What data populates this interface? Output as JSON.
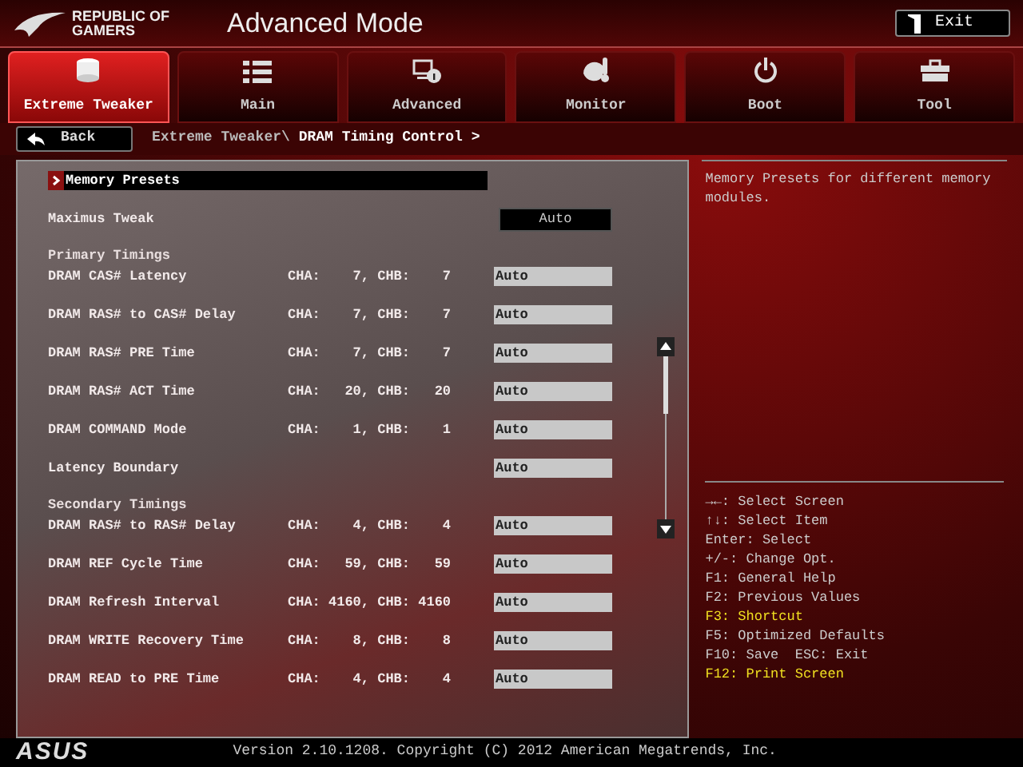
{
  "header": {
    "brand": [
      "REPUBLIC OF",
      "GAMERS"
    ],
    "title": "Advanced Mode",
    "exit_button": "Exit"
  },
  "tabs": [
    {
      "label": "Extreme Tweaker",
      "selected": true
    },
    {
      "label": "Main",
      "selected": false
    },
    {
      "label": "Advanced",
      "selected": false
    },
    {
      "label": "Monitor",
      "selected": false
    },
    {
      "label": "Boot",
      "selected": false
    },
    {
      "label": "Tool",
      "selected": false
    }
  ],
  "back_button": "Back",
  "breadcrumb": {
    "parent": "Extreme Tweaker\\",
    "current": "DRAM Timing Control >"
  },
  "items": [
    {
      "kind": "submenu",
      "label": "Memory Presets",
      "selected": true
    },
    {
      "kind": "option",
      "label": "Maximus Tweak",
      "value": "Auto",
      "selected": false
    },
    {
      "kind": "section",
      "label": "Primary Timings"
    },
    {
      "kind": "timing",
      "label": "DRAM CAS# Latency",
      "reading": "CHA:    7, CHB:    7",
      "value": "Auto",
      "selected": false
    },
    {
      "kind": "timing",
      "label": "DRAM RAS# to CAS# Delay",
      "reading": "CHA:    7, CHB:    7",
      "value": "Auto",
      "selected": false
    },
    {
      "kind": "timing",
      "label": "DRAM RAS# PRE Time",
      "reading": "CHA:    7, CHB:    7",
      "value": "Auto",
      "selected": false
    },
    {
      "kind": "timing",
      "label": "DRAM RAS# ACT Time",
      "reading": "CHA:   20, CHB:   20",
      "value": "Auto",
      "selected": false
    },
    {
      "kind": "timing",
      "label": "DRAM COMMAND Mode",
      "reading": "CHA:    1, CHB:    1",
      "value": "Auto",
      "selected": false
    },
    {
      "kind": "timing",
      "label": "Latency Boundary",
      "value": "Auto",
      "selected": false
    },
    {
      "kind": "section",
      "label": "Secondary Timings"
    },
    {
      "kind": "timing",
      "label": "DRAM RAS# to RAS# Delay",
      "reading": "CHA:    4, CHB:    4",
      "value": "Auto",
      "selected": false
    },
    {
      "kind": "timing",
      "label": "DRAM REF Cycle Time",
      "reading": "CHA:   59, CHB:   59",
      "value": "Auto",
      "selected": false
    },
    {
      "kind": "timing",
      "label": "DRAM Refresh Interval",
      "reading": "CHA: 4160, CHB: 4160",
      "value": "Auto",
      "selected": false
    },
    {
      "kind": "timing",
      "label": "DRAM WRITE Recovery Time",
      "reading": "CHA:    8, CHB:    8",
      "value": "Auto",
      "selected": false
    },
    {
      "kind": "timing",
      "label": "DRAM READ to PRE Time",
      "reading": "CHA:    4, CHB:    4",
      "value": "Auto",
      "selected": false
    }
  ],
  "help_text": "Memory Presets for different memory modules.",
  "shortcuts": [
    {
      "text": "→←: Select Screen",
      "highlighted": false
    },
    {
      "text": "↑↓: Select Item",
      "highlighted": false
    },
    {
      "text": "Enter: Select",
      "highlighted": false
    },
    {
      "text": "+/-: Change Opt.",
      "highlighted": false
    },
    {
      "text": "F1: General Help",
      "highlighted": false
    },
    {
      "text": "F2: Previous Values",
      "highlighted": false
    },
    {
      "text": "F3: Shortcut",
      "highlighted": true
    },
    {
      "text": "F5: Optimized Defaults",
      "highlighted": false
    },
    {
      "text": "F10: Save  ESC: Exit",
      "highlighted": false
    },
    {
      "text": "F12: Print Screen",
      "highlighted": true
    }
  ],
  "footer": {
    "logo": "ASUS",
    "version": "Version 2.10.1208. Copyright (C) 2012 American Megatrends, Inc."
  }
}
